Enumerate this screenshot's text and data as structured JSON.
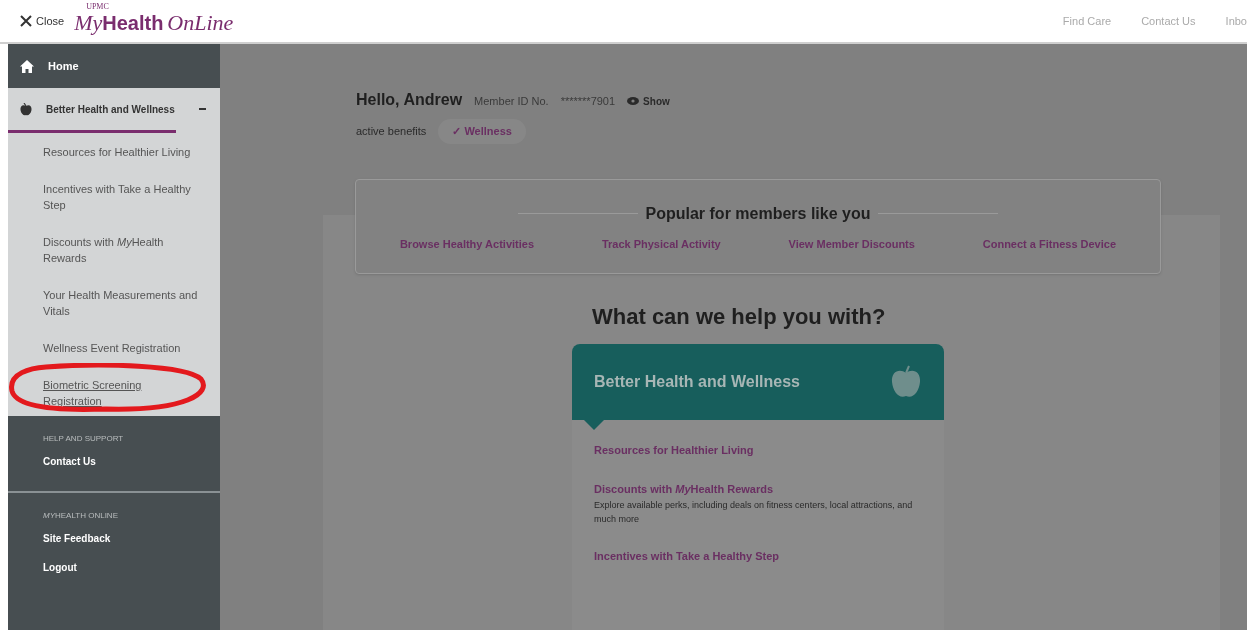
{
  "header": {
    "close_label": "Close",
    "logo": {
      "small": "UPMC",
      "my": "My",
      "health": "Health",
      "online": "OnLine"
    },
    "nav": [
      "Find Care",
      "Contact Us",
      "Inbo"
    ]
  },
  "sidebar": {
    "home": {
      "label": "Home"
    },
    "section": {
      "label": "Better Health and Wellness",
      "expanded": true,
      "items": [
        {
          "label": "Resources for Healthier Living",
          "hovered": false
        },
        {
          "label": "Incentives with Take a Healthy Step",
          "hovered": false
        },
        {
          "label_parts": [
            {
              "text": "Discounts with ",
              "italic": false
            },
            {
              "text": "My",
              "italic": true
            },
            {
              "text": "Health Rewards",
              "italic": false
            }
          ],
          "hovered": false
        },
        {
          "label": "Your Health Measurements and Vitals",
          "hovered": false
        },
        {
          "label": "Wellness Event Registration",
          "hovered": false
        },
        {
          "label": "Biometric Screening Registration",
          "hovered": true
        }
      ]
    },
    "groups": [
      {
        "heading": "HELP AND SUPPORT",
        "items": [
          "Contact Us"
        ]
      },
      {
        "heading_parts": [
          {
            "text": "MY",
            "italic": true
          },
          {
            "text": "HEALTH ONLINE",
            "italic": false
          }
        ],
        "items": [
          "Site Feedback",
          "Logout"
        ]
      }
    ]
  },
  "main": {
    "greeting": "Hello, Andrew",
    "member_id_label": "Member ID No.",
    "member_id": "*******7901",
    "show_label": "Show",
    "benefits_label": "active benefits",
    "benefit_badge": "✓ Wellness",
    "popular": {
      "title": "Popular for members like you",
      "links": [
        "Browse Healthy Activities",
        "Track Physical Activity",
        "View Member Discounts",
        "Connect a Fitness Device"
      ]
    },
    "help_title": "What can we help you with?",
    "help_card": {
      "title": "Better Health and Wellness",
      "items": [
        {
          "title": "Resources for Healthier Living"
        },
        {
          "title_parts": [
            {
              "text": "Discounts with ",
              "italic": false
            },
            {
              "text": "My",
              "italic": true
            },
            {
              "text": "Health Rewards",
              "italic": false
            }
          ],
          "description": "Explore available perks, including deals on fitness centers, local attractions, and much more"
        },
        {
          "title": "Incentives with Take a Healthy Step"
        }
      ]
    }
  }
}
